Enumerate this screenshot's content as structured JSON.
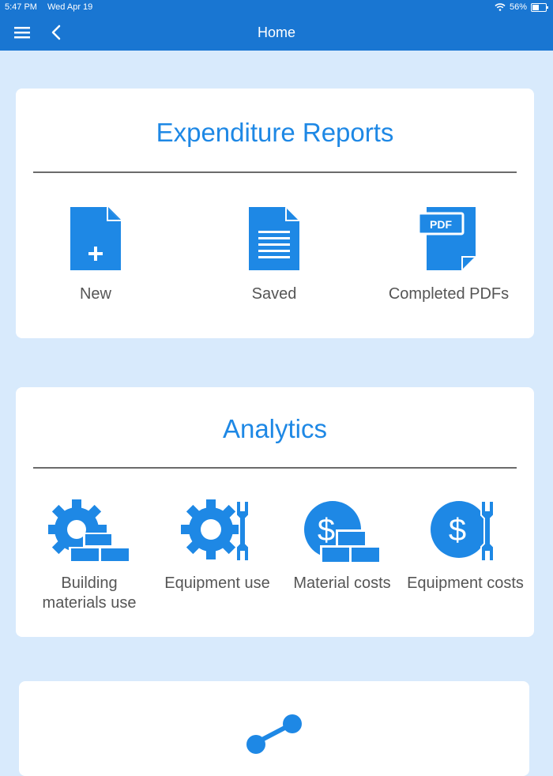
{
  "status_bar": {
    "time": "5:47 PM",
    "date": "Wed Apr 19",
    "battery": "56%",
    "battery_level": 0.56
  },
  "nav": {
    "title": "Home",
    "menu_icon": "hamburger-menu-icon",
    "back_icon": "chevron-left-icon"
  },
  "expenditure": {
    "title": "Expenditure Reports",
    "items": [
      {
        "label": "New",
        "icon": "new-document-icon"
      },
      {
        "label": "Saved",
        "icon": "saved-document-icon"
      },
      {
        "label": "Completed PDFs",
        "icon": "pdf-document-icon",
        "badge": "PDF"
      }
    ]
  },
  "analytics": {
    "title": "Analytics",
    "items": [
      {
        "label_line1": "Building",
        "label_line2": "materials use",
        "icon": "gear-bricks-icon"
      },
      {
        "label": "Equipment use",
        "icon": "gear-wrench-icon"
      },
      {
        "label": "Material costs",
        "icon": "dollar-bricks-icon"
      },
      {
        "label": "Equipment costs",
        "icon": "dollar-wrench-icon"
      }
    ]
  },
  "colors": {
    "accent": "#1e88e5",
    "header": "#1976d2",
    "background": "#d8eafc"
  }
}
